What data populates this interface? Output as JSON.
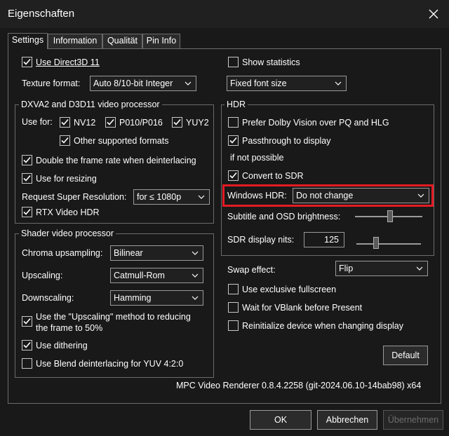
{
  "window": {
    "title": "Eigenschaften"
  },
  "tabs": [
    "Settings",
    "Information",
    "Qualität",
    "Pin Info"
  ],
  "left": {
    "use_d3d11": "Use Direct3D 11",
    "texture_format_label": "Texture format:",
    "texture_format_value": "Auto 8/10-bit Integer",
    "dxva": {
      "title": "DXVA2 and D3D11 video processor",
      "use_for_label": "Use for:",
      "nv12": "NV12",
      "p010": "P010/P016",
      "yuy2": "YUY2",
      "other": "Other supported formats",
      "double_rate": "Double the frame rate when deinterlacing",
      "resizing": "Use for resizing",
      "super_res_label": "Request Super Resolution:",
      "super_res_value": "for ≤ 1080p",
      "rtx_hdr": "RTX Video HDR"
    },
    "shader": {
      "title": "Shader video processor",
      "chroma_label": "Chroma upsampling:",
      "chroma_value": "Bilinear",
      "upscaling_label": "Upscaling:",
      "upscaling_value": "Catmull-Rom",
      "downscaling_label": "Downscaling:",
      "downscaling_value": "Hamming",
      "upscaling_method_1": "Use the \"Upscaling\" method to reducing",
      "upscaling_method_2": "the frame to 50%",
      "dithering": "Use dithering",
      "blend": "Use Blend deinterlacing for YUV 4:2:0"
    }
  },
  "right": {
    "show_stats": "Show statistics",
    "font_size_value": "Fixed font size",
    "hdr": {
      "title": "HDR",
      "prefer_dolby": "Prefer Dolby Vision over PQ and HLG",
      "passthrough": "Passthrough to display",
      "if_not_possible": "if not possible",
      "convert_sdr": "Convert to SDR",
      "windows_hdr_label": "Windows HDR:",
      "windows_hdr_value": "Do not change",
      "subtitle_label": "Subtitle and OSD brightness:",
      "subtitle_level": 0.52,
      "sdr_nits_label": "SDR display nits:",
      "sdr_nits_value": "125",
      "sdr_nits_level": 0.3
    },
    "swap_label": "Swap effect:",
    "swap_value": "Flip",
    "exclusive": "Use exclusive fullscreen",
    "vblank": "Wait for VBlank before Present",
    "reinit": "Reinitialize device when changing display",
    "default_button": "Default"
  },
  "version": "MPC Video Renderer 0.8.4.2258 (git-2024.06.10-14bab98) x64",
  "buttons": {
    "ok": "OK",
    "cancel": "Abbrechen",
    "apply": "Übernehmen"
  },
  "colors": {
    "highlight": "#e41b23"
  }
}
